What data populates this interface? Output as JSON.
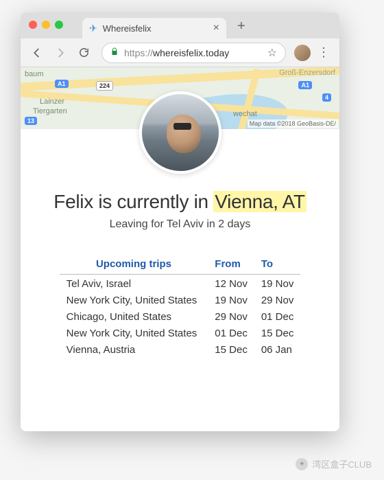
{
  "browser": {
    "tab_title": "Whereisfelix",
    "url_scheme": "https://",
    "url_host": "whereisfelix.today"
  },
  "map": {
    "labels": {
      "lainzer": "Lainzer",
      "tiergarten": "Tiergarten",
      "baum": "baum",
      "gross": "Groß-Enzersdorf",
      "wechat": "wechat"
    },
    "badges": {
      "a1_left": "A1",
      "a1_right": "A1",
      "b13": "13",
      "b224": "224",
      "b4": "4"
    },
    "attribution": "Map data ©2018 GeoBasis-DE/"
  },
  "headline": {
    "prefix": "Felix is currently in ",
    "location": "Vienna, AT"
  },
  "subline": "Leaving for Tel Aviv in 2 days",
  "table": {
    "headers": {
      "dest": "Upcoming trips",
      "from": "From",
      "to": "To"
    },
    "rows": [
      {
        "dest": "Tel Aviv, Israel",
        "from": "12 Nov",
        "to": "19 Nov"
      },
      {
        "dest": "New York City, United States",
        "from": "19 Nov",
        "to": "29 Nov"
      },
      {
        "dest": "Chicago, United States",
        "from": "29 Nov",
        "to": "01 Dec"
      },
      {
        "dest": "New York City, United States",
        "from": "01 Dec",
        "to": "15 Dec"
      },
      {
        "dest": "Vienna, Austria",
        "from": "15 Dec",
        "to": "06 Jan"
      }
    ]
  },
  "watermark": "湾区盒子CLUB"
}
